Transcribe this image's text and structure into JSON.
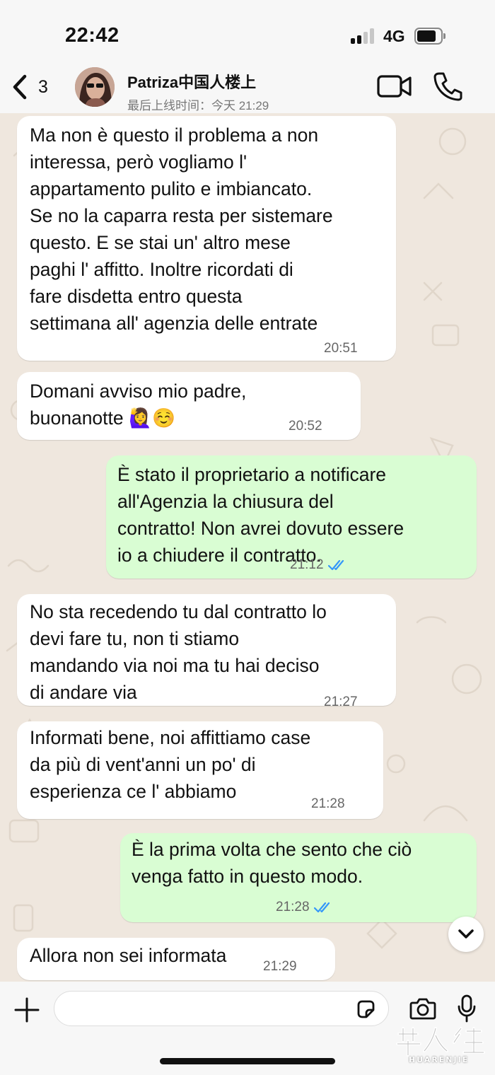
{
  "status_bar": {
    "time": "22:42",
    "network": "4G",
    "signal_bars": 2,
    "battery_level": 0.8
  },
  "header": {
    "back_count": "3",
    "contact_name": "Patriza中国人楼上",
    "last_seen": "最后上线时间：今天 21:29",
    "icons": [
      "back-chevron-icon",
      "video-call-icon",
      "phone-call-icon"
    ]
  },
  "messages": [
    {
      "direction": "in",
      "text": "Ma non è questo il problema a non\ninteressa, però vogliamo l'\nappartamento pulito e imbiancato.\nSe no la caparra resta per sistemare\nquesto. E se stai un' altro mese\npaghi l' affitto. Inoltre ricordati di\nfare disdetta entro questa\nsettimana all' agenzia delle entrate",
      "time": "20:51"
    },
    {
      "direction": "in",
      "text": "Domani avviso mio padre,\nbuonanotte 🙋‍♀️☺️",
      "time": "20:52"
    },
    {
      "direction": "out",
      "text": "È stato il proprietario a notificare\nall'Agenzia la chiusura del\ncontratto! Non avrei dovuto essere\nio a chiudere il contratto.",
      "time": "21:12",
      "read": true
    },
    {
      "direction": "in",
      "text": "No sta recedendo tu dal contratto lo\ndevi fare tu, non ti stiamo\nmandando via noi ma tu hai deciso\ndi andare via",
      "time": "21:27"
    },
    {
      "direction": "in",
      "text": "Informati bene, noi affittiamo case\nda più di vent'anni un po' di\nesperienza ce l' abbiamo",
      "time": "21:28"
    },
    {
      "direction": "out",
      "text": "È la prima volta che sento che ciò\nvenga fatto in questo modo.",
      "time": "21:28",
      "read": true
    },
    {
      "direction": "in",
      "text": "Allora non sei informata",
      "time": "21:29"
    }
  ],
  "composer": {
    "input_value": "",
    "icons": [
      "plus-icon",
      "sticker-icon",
      "camera-icon",
      "microphone-icon"
    ]
  },
  "watermark": {
    "text": "华人街",
    "subtext": "HUARENJIE"
  },
  "colors": {
    "incoming_bubble": "#ffffff",
    "outgoing_bubble": "#d9fdd3",
    "read_ticks": "#3497f9",
    "wallpaper": "#efe7de"
  }
}
